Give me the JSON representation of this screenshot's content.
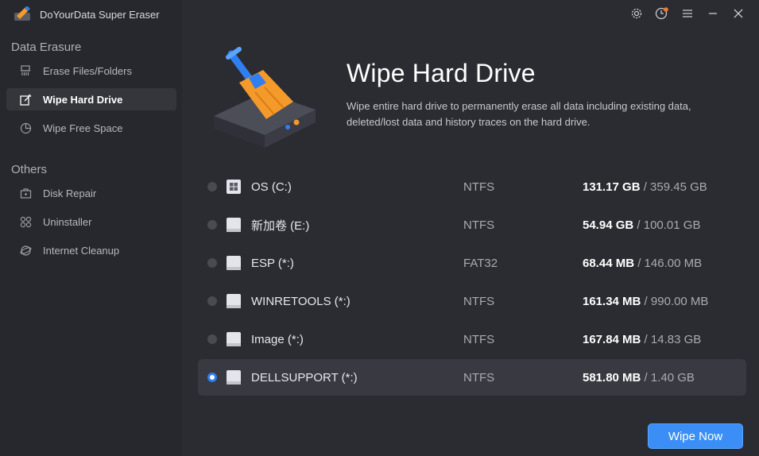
{
  "app": {
    "title": "DoYourData Super Eraser"
  },
  "sidebar": {
    "sections": [
      {
        "title": "Data Erasure",
        "items": [
          {
            "label": "Erase Files/Folders",
            "icon": "shredder-icon",
            "active": false
          },
          {
            "label": "Wipe Hard Drive",
            "icon": "edit-icon",
            "active": true
          },
          {
            "label": "Wipe Free Space",
            "icon": "pie-icon",
            "active": false
          }
        ]
      },
      {
        "title": "Others",
        "items": [
          {
            "label": "Disk Repair",
            "icon": "toolbox-icon",
            "active": false
          },
          {
            "label": "Uninstaller",
            "icon": "apps-icon",
            "active": false
          },
          {
            "label": "Internet Cleanup",
            "icon": "globe-icon",
            "active": false
          }
        ]
      }
    ]
  },
  "header": {
    "title": "Wipe Hard Drive",
    "description": "Wipe entire hard drive to permanently erase all data including existing data, deleted/lost data and history traces on the hard drive."
  },
  "drives": [
    {
      "name": "OS (C:)",
      "fs": "NTFS",
      "used": "131.17 GB",
      "total": "/ 359.45 GB",
      "icon": "windows-drive-icon",
      "selected": false
    },
    {
      "name": "新加卷 (E:)",
      "fs": "NTFS",
      "used": "54.94 GB",
      "total": "/ 100.01 GB",
      "icon": "drive-icon",
      "selected": false
    },
    {
      "name": "ESP (*:)",
      "fs": "FAT32",
      "used": "68.44 MB",
      "total": "/ 146.00 MB",
      "icon": "drive-icon",
      "selected": false
    },
    {
      "name": "WINRETOOLS (*:)",
      "fs": "NTFS",
      "used": "161.34 MB",
      "total": "/ 990.00 MB",
      "icon": "drive-icon",
      "selected": false
    },
    {
      "name": "Image (*:)",
      "fs": "NTFS",
      "used": "167.84 MB",
      "total": "/ 14.83 GB",
      "icon": "drive-icon",
      "selected": false
    },
    {
      "name": "DELLSUPPORT (*:)",
      "fs": "NTFS",
      "used": "581.80 MB",
      "total": "/ 1.40 GB",
      "icon": "drive-icon",
      "selected": true
    }
  ],
  "actions": {
    "wipe_label": "Wipe Now"
  },
  "colors": {
    "accent": "#3a8ef6",
    "sidebar_bg": "#27282d",
    "main_bg": "#2b2c32",
    "brush_orange": "#f39a2a",
    "brush_blue": "#2f7ff0"
  }
}
